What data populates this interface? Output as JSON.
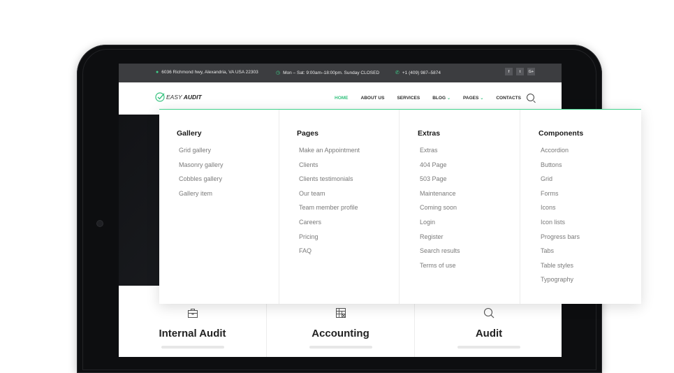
{
  "topbar": {
    "address": "6036 Richmond hwy, Alexandria, VA USA 22303",
    "hours": "Mon – Sat: 9:00am–18:00pm. Sunday CLOSED",
    "phone": "+1 (409) 987–5874",
    "social": [
      "f",
      "t",
      "G+"
    ]
  },
  "logo": {
    "light": "EASY",
    "bold": "AUDIT"
  },
  "nav": {
    "items": [
      "HOME",
      "ABOUT US",
      "SERVICES",
      "BLOG",
      "PAGES",
      "CONTACTS"
    ],
    "active": "HOME",
    "accent_color": "#35c27e"
  },
  "mega_menu": {
    "columns": [
      {
        "title": "Gallery",
        "items": [
          "Grid gallery",
          "Masonry gallery",
          "Cobbles gallery",
          "Gallery item"
        ]
      },
      {
        "title": "Pages",
        "items": [
          "Make an Appointment",
          "Clients",
          "Clients testimonials",
          "Our team",
          "Team member profile",
          "Careers",
          "Pricing",
          "FAQ"
        ]
      },
      {
        "title": "Extras",
        "items": [
          "Extras",
          "404 Page",
          "503 Page",
          "Maintenance",
          "Coming soon",
          "Login",
          "Register",
          "Search results",
          "Terms of use"
        ]
      },
      {
        "title": "Components",
        "items": [
          "Accordion",
          "Buttons",
          "Grid",
          "Forms",
          "Icons",
          "Icon lists",
          "Progress bars",
          "Tabs",
          "Table styles",
          "Typography"
        ]
      }
    ]
  },
  "services": [
    {
      "title": "Internal Audit",
      "icon": "briefcase-icon"
    },
    {
      "title": "Accounting",
      "icon": "spreadsheet-icon"
    },
    {
      "title": "Audit",
      "icon": "search-icon"
    }
  ]
}
